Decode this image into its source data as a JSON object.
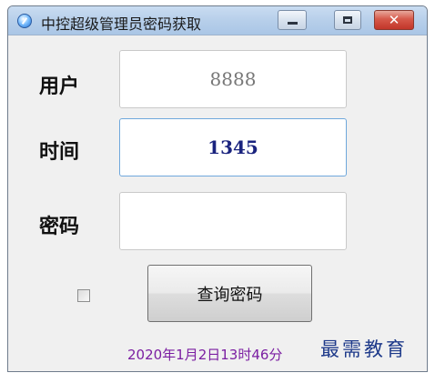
{
  "window": {
    "title": "中控超级管理员密码获取",
    "controls": {
      "minimize_icon": "minimize-icon",
      "maximize_icon": "maximize-icon",
      "close_icon": "close-icon",
      "close_glyph": "✕"
    }
  },
  "form": {
    "user": {
      "label": "用户",
      "value": "8888"
    },
    "time": {
      "label": "时间",
      "value": "1345"
    },
    "password": {
      "label": "密码",
      "value": ""
    }
  },
  "checkbox": {
    "checked": false
  },
  "query_button": {
    "label": "查询密码"
  },
  "status": {
    "datetime": "2020年1月2日13时46分"
  },
  "watermark": {
    "text": "最需教育"
  },
  "colors": {
    "title_bar": "#b7cfea",
    "close_button": "#d6594a",
    "time_text": "#1a237e",
    "datetime_text": "#7b1fa2",
    "watermark_text": "#1e3a8a",
    "focused_border": "#6fa8dc"
  }
}
